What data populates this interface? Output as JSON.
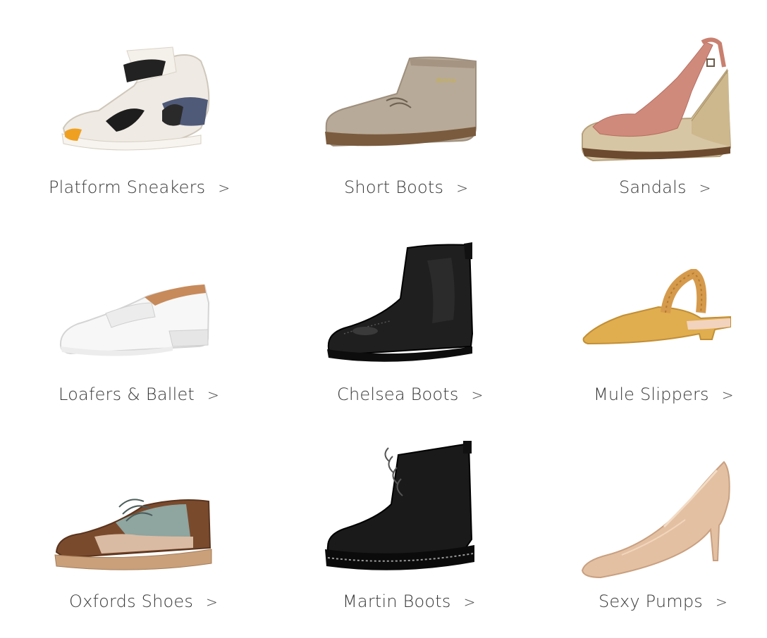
{
  "categories": [
    {
      "label": "Platform Sneakers",
      "icon": "platform-sneaker-icon"
    },
    {
      "label": "Short Boots",
      "icon": "short-boot-icon"
    },
    {
      "label": "Sandals",
      "icon": "wedge-sandal-icon"
    },
    {
      "label": "Loafers & Ballet",
      "icon": "loafer-icon"
    },
    {
      "label": "Chelsea Boots",
      "icon": "chelsea-boot-icon"
    },
    {
      "label": "Mule Slippers",
      "icon": "mule-slipper-icon"
    },
    {
      "label": "Oxfords Shoes",
      "icon": "oxford-shoe-icon"
    },
    {
      "label": "Martin Boots",
      "icon": "martin-boot-icon"
    },
    {
      "label": "Sexy Pumps",
      "icon": "pump-icon"
    }
  ],
  "chevron": ">"
}
